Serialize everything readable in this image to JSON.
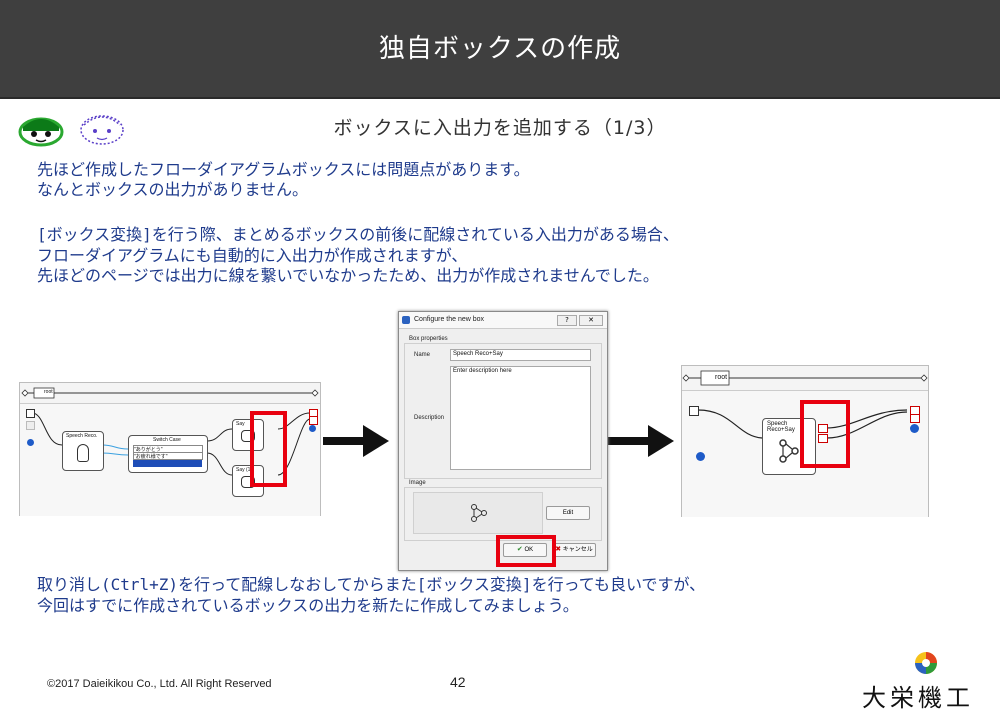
{
  "header": {
    "title": "独自ボックスの作成"
  },
  "subtitle": "ボックスに入出力を追加する（1/3）",
  "paragraphs": {
    "p1_line1": "先ほど作成したフローダイアグラムボックスには問題点があります。",
    "p1_line2": "なんとボックスの出力がありません。",
    "p2_line1": "[ボックス変換]を行う際、まとめるボックスの前後に配線されている入出力がある場合、",
    "p2_line2": "フローダイアグラムにも自動的に入出力が作成されますが、",
    "p2_line3": "先ほどのページでは出力に線を繋いでいなかったため、出力が作成されませんでした。",
    "p3_line1": "取り消し(Ctrl+Z)を行って配線しなおしてからまた[ボックス変換]を行っても良いですが、",
    "p3_line2": "今回はすでに作成されているボックスの出力を新たに作成してみましょう。"
  },
  "left_panel": {
    "root_label": "root",
    "speech_reco": "Speech Reco.",
    "switch_case": "Switch Case",
    "case1": "\"ありがとう\"",
    "case2": "\"お疲れ様です\"",
    "say1": "Say",
    "say2": "Say (1)"
  },
  "dialog": {
    "title": "Configure the new box",
    "section_box": "Box properties",
    "name_label": "Name",
    "name_value": "Speech Reco+Say",
    "desc_label": "Description",
    "desc_value": "Enter description here",
    "image_label": "Image",
    "edit_button": "Edit",
    "ok_button": "OK",
    "cancel_button": "キャンセル"
  },
  "right_panel": {
    "root_label": "root",
    "box_name": "Speech Reco+Say"
  },
  "footer": {
    "copyright": "©2017 Daieikikou Co., Ltd. All Right Reserved",
    "page_number": "42",
    "company_logo": "大栄機工"
  },
  "colors": {
    "header_bg": "#3f3f3f",
    "body_text": "#1f3b8c",
    "highlight_red": "#e8000f",
    "selected_case": "#1e4db7"
  }
}
